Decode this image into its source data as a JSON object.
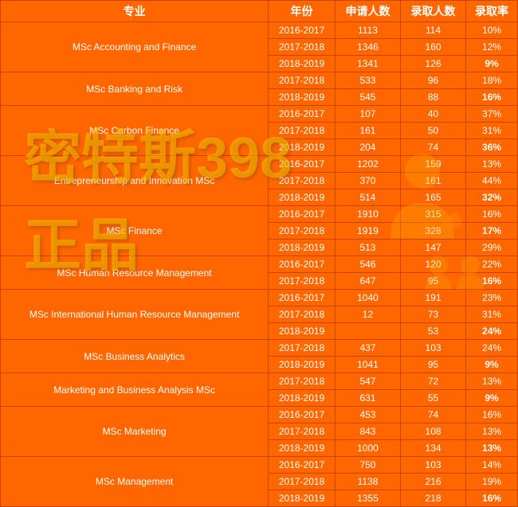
{
  "headers": [
    "专业",
    "年份",
    "申请人数",
    "录取人数",
    "录取率"
  ],
  "watermark_line1": "密特斯398",
  "watermark_line2": "正品",
  "rows": [
    {
      "major": "MSc Accounting and Finance",
      "years": [
        {
          "year": "2016-2017",
          "applied": "1113",
          "admitted": "114",
          "rate": "10%",
          "bold": false
        },
        {
          "year": "2017-2018",
          "applied": "1346",
          "admitted": "160",
          "rate": "12%",
          "bold": false
        },
        {
          "year": "2018-2019",
          "applied": "1341",
          "admitted": "126",
          "rate": "9%",
          "bold": true
        }
      ]
    },
    {
      "major": "MSc Banking and Risk",
      "years": [
        {
          "year": "2017-2018",
          "applied": "533",
          "admitted": "96",
          "rate": "18%",
          "bold": false
        },
        {
          "year": "2018-2019",
          "applied": "545",
          "admitted": "88",
          "rate": "16%",
          "bold": true
        }
      ]
    },
    {
      "major": "MSc Carbon Finance",
      "years": [
        {
          "year": "2016-2017",
          "applied": "107",
          "admitted": "40",
          "rate": "37%",
          "bold": false
        },
        {
          "year": "2017-2018",
          "applied": "161",
          "admitted": "50",
          "rate": "31%",
          "bold": false
        },
        {
          "year": "2018-2019",
          "applied": "204",
          "admitted": "74",
          "rate": "36%",
          "bold": true
        }
      ]
    },
    {
      "major": "Entrepreneurship and Innovation MSc",
      "years": [
        {
          "year": "2016-2017",
          "applied": "1202",
          "admitted": "159",
          "rate": "13%",
          "bold": false
        },
        {
          "year": "2017-2018",
          "applied": "370",
          "admitted": "161",
          "rate": "44%",
          "bold": false
        },
        {
          "year": "2018-2019",
          "applied": "514",
          "admitted": "165",
          "rate": "32%",
          "bold": true
        }
      ]
    },
    {
      "major": "MSc Finance",
      "years": [
        {
          "year": "2016-2017",
          "applied": "1910",
          "admitted": "315",
          "rate": "16%",
          "bold": false
        },
        {
          "year": "2017-2018",
          "applied": "1919",
          "admitted": "328",
          "rate": "17%",
          "bold": true
        },
        {
          "year": "2018-2019",
          "applied": "513",
          "admitted": "147",
          "rate": "29%",
          "bold": false
        }
      ]
    },
    {
      "major": "MSc Human Resource Management",
      "years": [
        {
          "year": "2016-2017",
          "applied": "546",
          "admitted": "120",
          "rate": "22%",
          "bold": false
        },
        {
          "year": "2017-2018",
          "applied": "647",
          "admitted": "95",
          "rate": "16%",
          "bold": true
        }
      ]
    },
    {
      "major": "MSc International Human Resource Management",
      "years": [
        {
          "year": "2016-2017",
          "applied": "1040",
          "admitted": "191",
          "rate": "23%",
          "bold": false
        },
        {
          "year": "2017-2018",
          "applied": "12",
          "admitted": "73",
          "rate": "31%",
          "bold": false
        },
        {
          "year": "2018-2019",
          "applied": "",
          "admitted": "53",
          "rate": "24%",
          "bold": true
        }
      ]
    },
    {
      "major": "MSc Business Analytics",
      "years": [
        {
          "year": "2017-2018",
          "applied": "437",
          "admitted": "103",
          "rate": "24%",
          "bold": false
        },
        {
          "year": "2018-2019",
          "applied": "1041",
          "admitted": "95",
          "rate": "9%",
          "bold": true
        }
      ]
    },
    {
      "major": "Marketing and Business Analysis MSc",
      "years": [
        {
          "year": "2017-2018",
          "applied": "547",
          "admitted": "72",
          "rate": "13%",
          "bold": false
        },
        {
          "year": "2018-2019",
          "applied": "631",
          "admitted": "55",
          "rate": "9%",
          "bold": true
        }
      ]
    },
    {
      "major": "MSc Marketing",
      "years": [
        {
          "year": "2016-2017",
          "applied": "453",
          "admitted": "74",
          "rate": "16%",
          "bold": false
        },
        {
          "year": "2017-2018",
          "applied": "843",
          "admitted": "108",
          "rate": "13%",
          "bold": false
        },
        {
          "year": "2018-2019",
          "applied": "1000",
          "admitted": "134",
          "rate": "13%",
          "bold": true
        }
      ]
    },
    {
      "major": "MSc Management",
      "years": [
        {
          "year": "2016-2017",
          "applied": "750",
          "admitted": "103",
          "rate": "14%",
          "bold": false
        },
        {
          "year": "2017-2018",
          "applied": "1138",
          "admitted": "216",
          "rate": "19%",
          "bold": false
        },
        {
          "year": "2018-2019",
          "applied": "1355",
          "admitted": "218",
          "rate": "16%",
          "bold": true
        }
      ]
    }
  ]
}
